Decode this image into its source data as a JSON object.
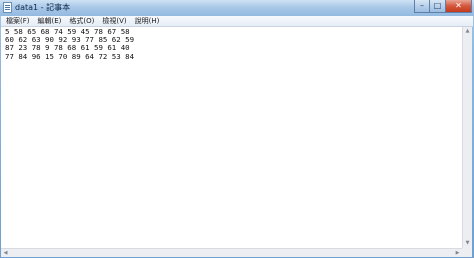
{
  "window": {
    "title": "data1 - 記事本",
    "minimize_glyph": "–",
    "maximize_glyph": "□",
    "close_glyph": "✕"
  },
  "menu": {
    "items": [
      {
        "label": "檔案(F)"
      },
      {
        "label": "編輯(E)"
      },
      {
        "label": "格式(O)"
      },
      {
        "label": "檢視(V)"
      },
      {
        "label": "說明(H)"
      }
    ]
  },
  "editor": {
    "content": "5 58 65 68 74 59 45 78 67 58\n60 62 63 90 92 93 77 85 62 59\n87 23 78 9 78 68 61 59 61 40\n77 84 96 15 70 89 64 72 53 84"
  },
  "scrollbars": {
    "up_glyph": "▲",
    "down_glyph": "▼",
    "left_glyph": "◀",
    "right_glyph": "▶"
  }
}
